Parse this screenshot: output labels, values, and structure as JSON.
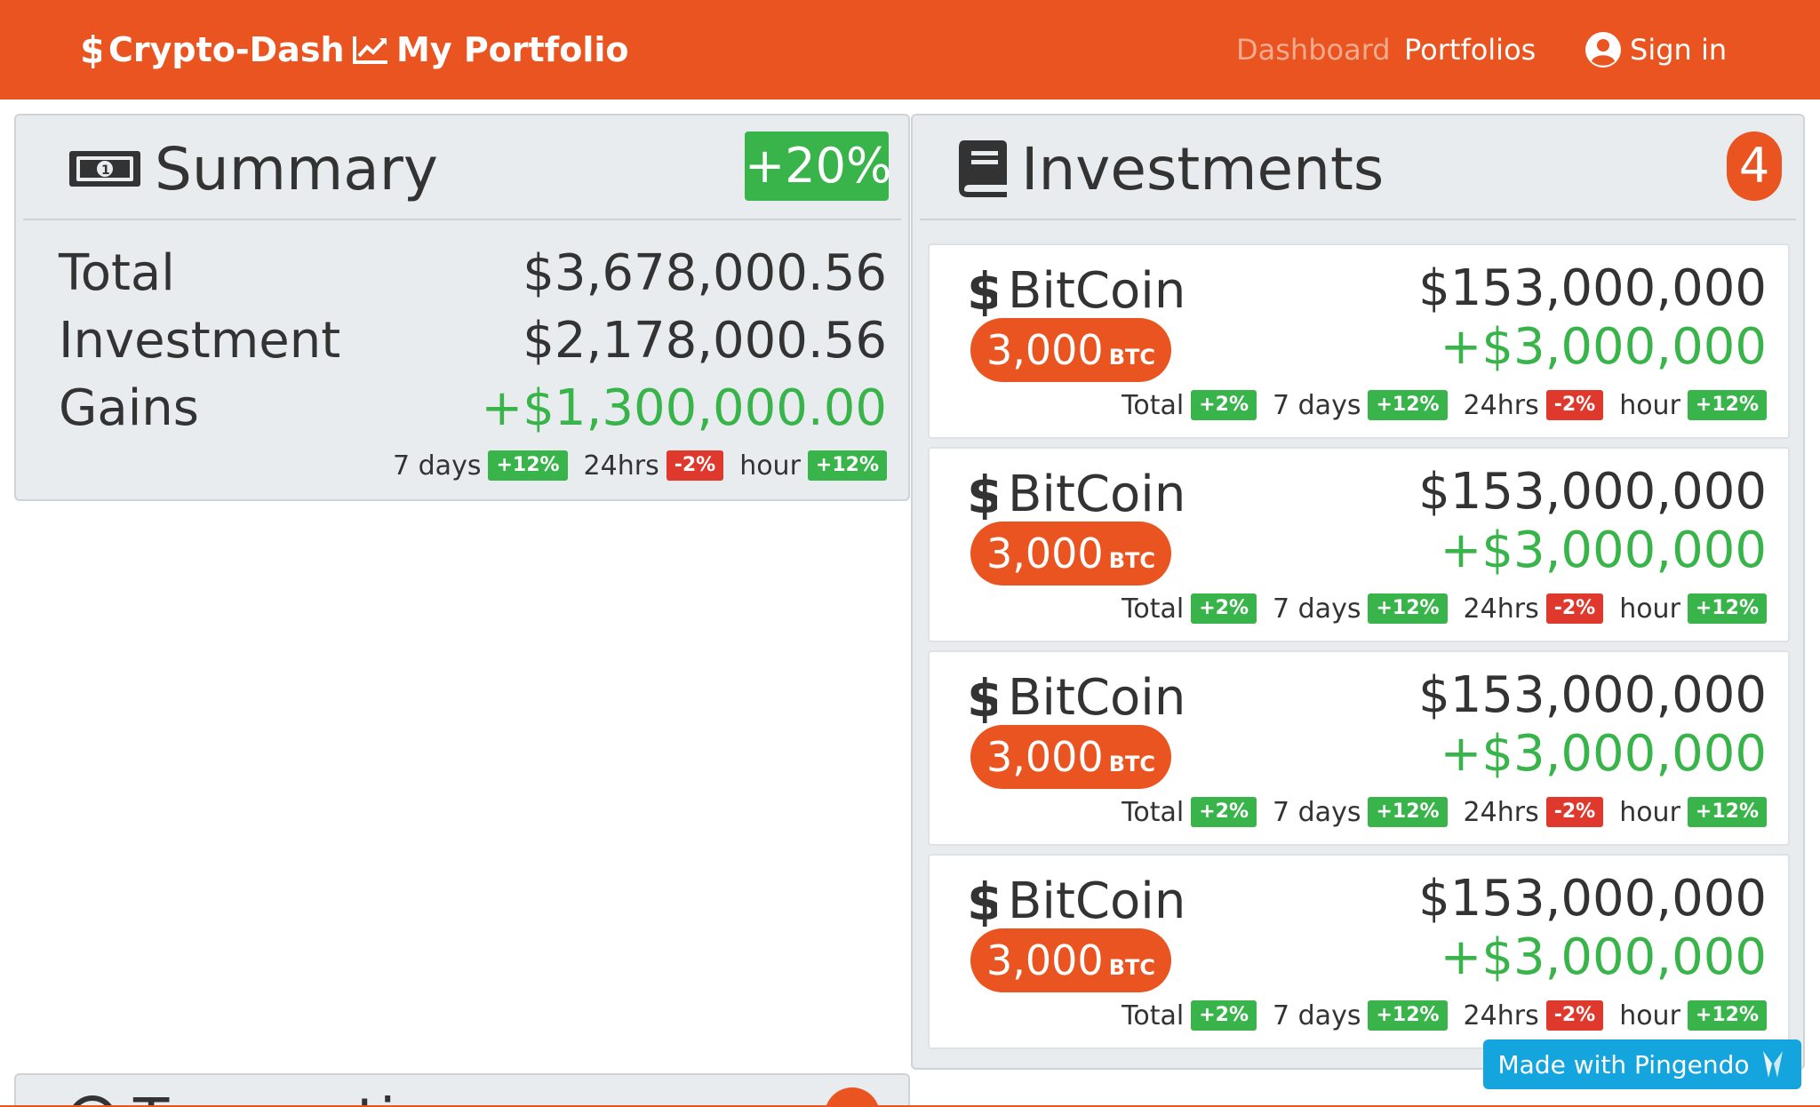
{
  "navbar": {
    "brand": "Crypto-Dash",
    "portfolio": "My Portfolio",
    "links": {
      "dashboard": "Dashboard",
      "portfolios": "Portfolios",
      "signin": "Sign in"
    },
    "colors": {
      "bar": "#e95420"
    }
  },
  "summary": {
    "title": "Summary",
    "badge": "+20%",
    "rows": [
      {
        "label": "Total",
        "value": "$3,678,000.56"
      },
      {
        "label": "Investment",
        "value": "$2,178,000.56"
      },
      {
        "label": "Gains",
        "value": "+$1,300,000.00"
      }
    ],
    "stats": [
      {
        "label": "7 days",
        "value": "+12%"
      },
      {
        "label": "24hrs",
        "value": "-2%"
      },
      {
        "label": "hour",
        "value": "+12%"
      }
    ]
  },
  "investments": {
    "title": "Investments",
    "count": "4",
    "items": [
      {
        "name": "BitCoin",
        "qty": "3,000",
        "unit": "BTC",
        "value": "$153,000,000",
        "gain": "+$3,000,000",
        "stats": [
          {
            "label": "Total",
            "value": "+2%"
          },
          {
            "label": "7 days",
            "value": "+12%"
          },
          {
            "label": "24hrs",
            "value": "-2%"
          },
          {
            "label": "hour",
            "value": "+12%"
          }
        ]
      },
      {
        "name": "BitCoin",
        "qty": "3,000",
        "unit": "BTC",
        "value": "$153,000,000",
        "gain": "+$3,000,000",
        "stats": [
          {
            "label": "Total",
            "value": "+2%"
          },
          {
            "label": "7 days",
            "value": "+12%"
          },
          {
            "label": "24hrs",
            "value": "-2%"
          },
          {
            "label": "hour",
            "value": "+12%"
          }
        ]
      },
      {
        "name": "BitCoin",
        "qty": "3,000",
        "unit": "BTC",
        "value": "$153,000,000",
        "gain": "+$3,000,000",
        "stats": [
          {
            "label": "Total",
            "value": "+2%"
          },
          {
            "label": "7 days",
            "value": "+12%"
          },
          {
            "label": "24hrs",
            "value": "-2%"
          },
          {
            "label": "hour",
            "value": "+12%"
          }
        ]
      },
      {
        "name": "BitCoin",
        "qty": "3,000",
        "unit": "BTC",
        "value": "$153,000,000",
        "gain": "+$3,000,000",
        "stats": [
          {
            "label": "Total",
            "value": "+2%"
          },
          {
            "label": "7 days",
            "value": "+12%"
          },
          {
            "label": "24hrs",
            "value": "-2%"
          },
          {
            "label": "hour",
            "value": "+12%"
          }
        ]
      }
    ]
  },
  "transactions": {
    "title": "Transactions"
  },
  "pingendo": {
    "label": "Made with Pingendo"
  },
  "colors": {
    "up": "#38b44a",
    "down": "#df382c",
    "accent": "#e95420",
    "pingendo": "#14a4de"
  }
}
